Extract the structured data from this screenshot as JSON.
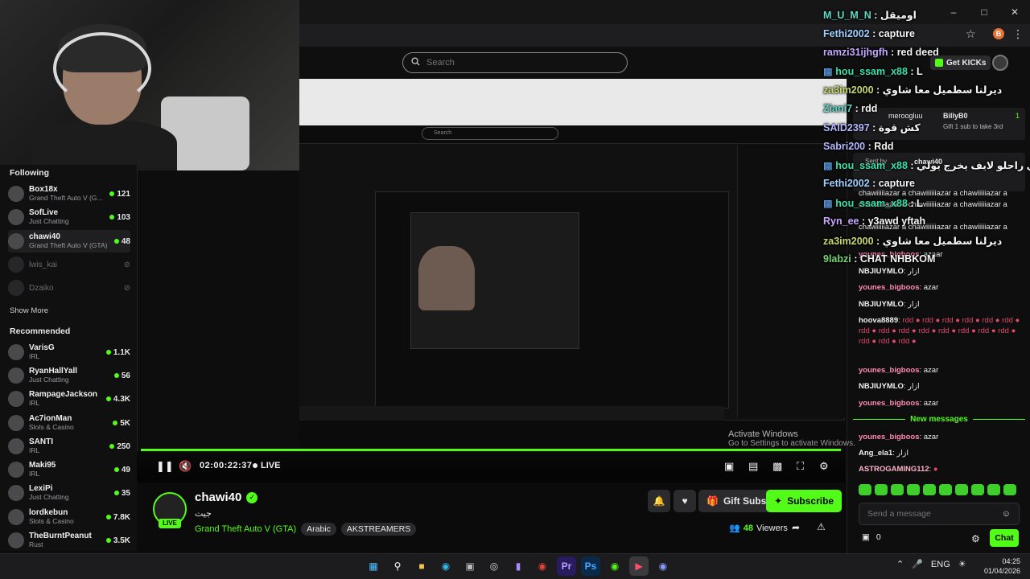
{
  "browser": {
    "search_placeholder": "Search",
    "get_kicks": "Get KICKs"
  },
  "sidebar": {
    "following_heading": "Following",
    "following": [
      {
        "name": "Box18x",
        "category": "Grand Theft Auto V (G...",
        "viewers": "121"
      },
      {
        "name": "SofLive",
        "category": "Just Chatting",
        "viewers": "103"
      },
      {
        "name": "chawi40",
        "category": "Grand Theft Auto V (GTA)",
        "viewers": "48"
      },
      {
        "name": "lwis_kai",
        "category": "",
        "viewers": ""
      },
      {
        "name": "Dzaiko",
        "category": "",
        "viewers": ""
      }
    ],
    "show_more": "Show More",
    "recommended_heading": "Recommended",
    "recommended": [
      {
        "name": "VarisG",
        "category": "IRL",
        "viewers": "1.1K"
      },
      {
        "name": "RyanHallYall",
        "category": "Just Chatting",
        "viewers": "56"
      },
      {
        "name": "RampageJackson",
        "category": "IRL",
        "viewers": "4.3K"
      },
      {
        "name": "Ac7ionMan",
        "category": "Slots & Casino",
        "viewers": "5K"
      },
      {
        "name": "SANTI",
        "category": "IRL",
        "viewers": "250"
      },
      {
        "name": "Maki95",
        "category": "IRL",
        "viewers": "49"
      },
      {
        "name": "LexiPi",
        "category": "Just Chatting",
        "viewers": "35"
      },
      {
        "name": "lordkebun",
        "category": "Slots & Casino",
        "viewers": "7.8K"
      },
      {
        "name": "TheBurntPeanut",
        "category": "Rust",
        "viewers": "3.5K"
      }
    ]
  },
  "player": {
    "time": "02:00:22:37",
    "live": "LIVE",
    "progress": 1.0
  },
  "channel": {
    "name": "chawi40",
    "live_badge": "LIVE",
    "title": "جيت",
    "game": "Grand Theft Auto V (GTA)",
    "tags": [
      "Arabic",
      "AKSTREAMERS"
    ],
    "gift_subs": "Gift Subs",
    "subscribe": "Subscribe",
    "viewers_count": "48",
    "viewers_label": "Viewers"
  },
  "chat": {
    "pinned_user": "meroogluu",
    "pinned_user2": "BillyB0",
    "pinned_count": "1",
    "pinned_sub": "Gift 1 sub to take 3rd",
    "sent_by_label": "Sent by",
    "sent_by_user": "chawi40",
    "messages": [
      {
        "user": "",
        "text": "chawiiiiiazar a chawiiiiiiazar a chawiiiiiazar a"
      },
      {
        "user": "",
        "text": "chawiiiiiazar a chawiiiiiiazar a chawiiiiiazar a"
      },
      {
        "user": "",
        "text": "chawiiiiiazar a chawiiiiiiazar a chawiiiiiazar a"
      },
      {
        "user": "younes_bigboos",
        "text": "azaar"
      },
      {
        "user": "NBJIUYMLO",
        "text": "ازار"
      },
      {
        "user": "younes_bigboos",
        "text": "azar"
      },
      {
        "user": "NBJIUYMLO",
        "text": "ازار"
      },
      {
        "user": "hoova8889",
        "text": "rdd ● rdd ● rdd ● rdd ● rdd ● rdd ● rdd ● rdd ● rdd ● rdd ● rdd ● rdd ● rdd ● rdd ● rdd ● rdd ● rdd ●"
      },
      {
        "user": "younes_bigboos",
        "text": "azar"
      },
      {
        "user": "NBJIUYMLO",
        "text": "ازار"
      },
      {
        "user": "younes_bigboos",
        "text": "azar"
      }
    ],
    "new_messages": "New messages",
    "after": [
      {
        "user": "younes_bigboos",
        "text": "azar"
      },
      {
        "user": "Ang_ela1",
        "text": "ازار"
      },
      {
        "user": "ASTROGAMING112",
        "text": "●"
      }
    ],
    "input_placeholder": "Send a message",
    "kicks_count": "0",
    "chat_button": "Chat"
  },
  "overlay": [
    {
      "user": "M_U_M_N",
      "text": "اوميقل"
    },
    {
      "user": "Fethi2002",
      "text": "capture"
    },
    {
      "user": "ramzi31ijhgfh",
      "text": "red deed"
    },
    {
      "user": "hou_ssam_x88",
      "text": "L"
    },
    {
      "user": "za3im2000",
      "text": "ديرلنا سطميل معا شاوي"
    },
    {
      "user": "Ziani7",
      "text": "rdd"
    },
    {
      "user": "SAID2397",
      "text": "كش قوة"
    },
    {
      "user": "Sabri200",
      "text": "Rdd"
    },
    {
      "user": "hou_ssam_x88",
      "text": "لي راحلو لايف يخرج يولي"
    },
    {
      "user": "Fethi2002",
      "text": "capture"
    },
    {
      "user": "hou_ssam_x88",
      "text": "L"
    },
    {
      "user": "Ryn_ee",
      "text": "y3awd yftah"
    },
    {
      "user": "za3im2000",
      "text": "ديرلنا سطميل معا شاوي"
    },
    {
      "user": "9labzi",
      "text": "CHAT NHBKOM"
    }
  ],
  "watermark": {
    "line1": "Activate Windows",
    "line2": "Go to Settings to activate Windows."
  },
  "taskbar": {
    "lang": "ENG",
    "time": "04:25",
    "date": "01/04/2026"
  }
}
